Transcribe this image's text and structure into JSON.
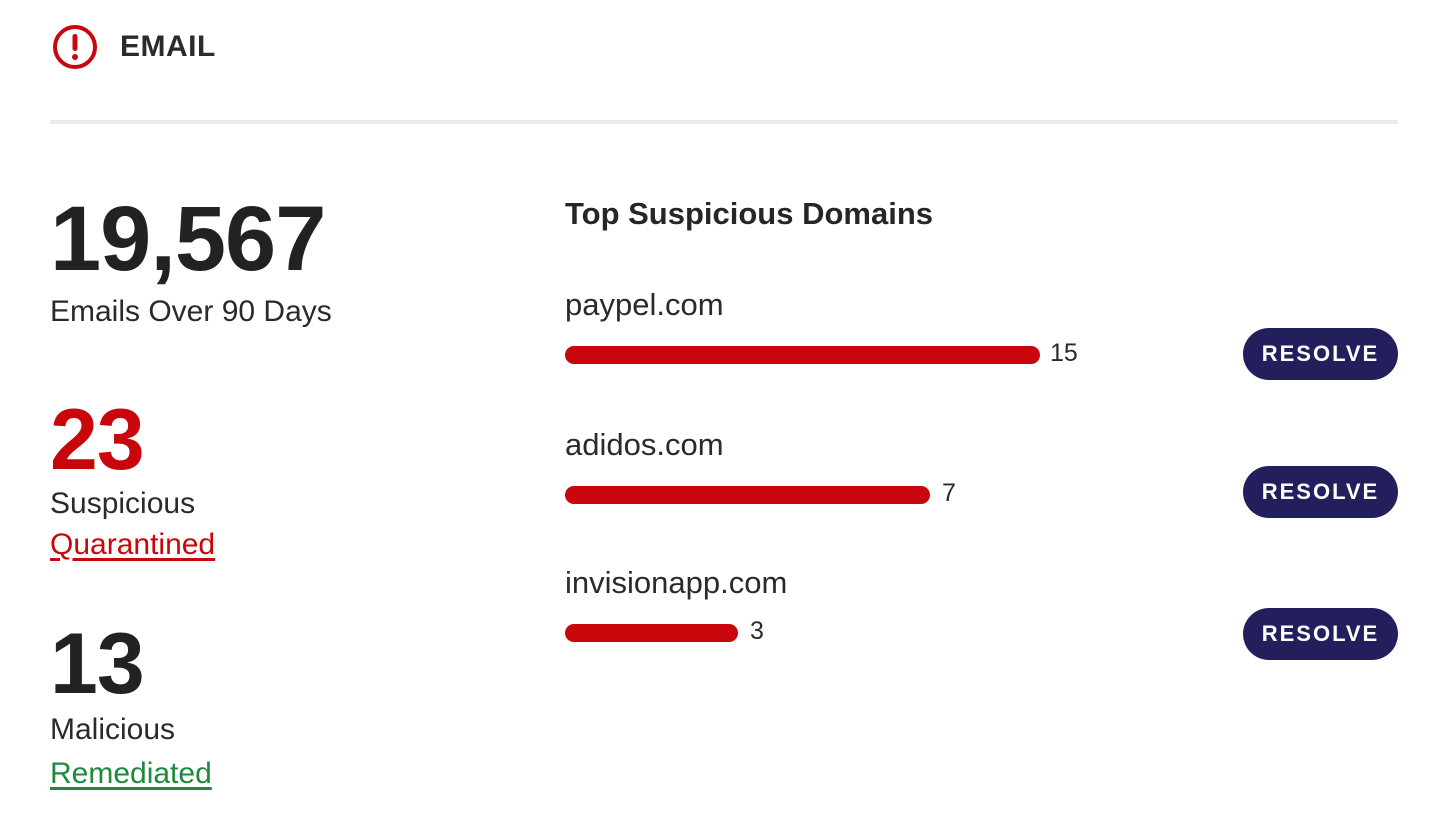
{
  "header": {
    "title": "EMAIL",
    "icon": "alert-circle-icon",
    "icon_color": "#c8060b"
  },
  "stats": {
    "total": {
      "value": "19,567",
      "label": "Emails Over 90 Days"
    },
    "suspicious": {
      "value": "23",
      "label": "Suspicious",
      "link": "Quarantined",
      "color": "#c8060b"
    },
    "malicious": {
      "value": "13",
      "label": "Malicious",
      "link": "Remediated",
      "link_color": "#1f8a3a"
    }
  },
  "domains": {
    "title": "Top Suspicious Domains",
    "items": [
      {
        "name": "paypel.com",
        "count": 15,
        "count_label": "15",
        "action": "RESOLVE"
      },
      {
        "name": "adidos.com",
        "count": 7,
        "count_label": "7",
        "action": "RESOLVE"
      },
      {
        "name": "invisionapp.com",
        "count": 3,
        "count_label": "3",
        "action": "RESOLVE"
      }
    ]
  },
  "colors": {
    "bar": "#c8060b",
    "button": "#231f5c",
    "divider": "#ebebeb"
  }
}
